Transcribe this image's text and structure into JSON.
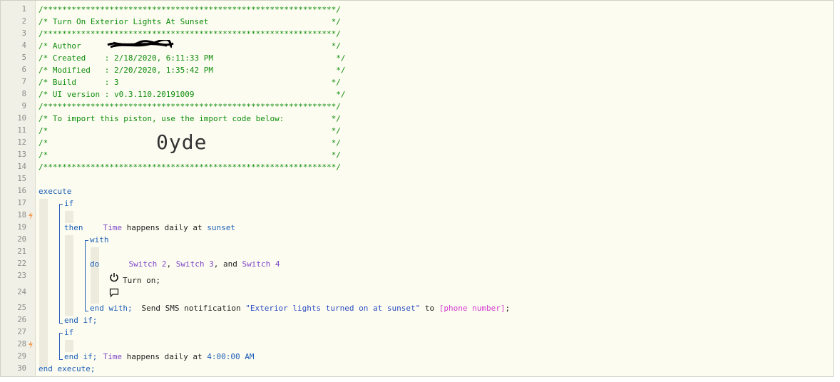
{
  "line_numbers": [
    "1",
    "2",
    "3",
    "4",
    "5",
    "6",
    "7",
    "8",
    "9",
    "10",
    "11",
    "12",
    "13",
    "14",
    "15",
    "16",
    "17",
    "18",
    "19",
    "20",
    "21",
    "22",
    "23",
    "24",
    "25",
    "26",
    "27",
    "28",
    "29",
    "30"
  ],
  "header": {
    "stars": "/**************************************************************/",
    "title": "/* Turn On Exterior Lights At Sunset                          */",
    "author": "/* Author                                                     */",
    "created": "/* Created    : 2/18/2020, 6:11:33 PM                          */",
    "modified": "/* Modified   : 2/20/2020, 1:35:42 PM                          */",
    "build": "/* Build      : 3                                             */",
    "ui_version": "/* UI version : v0.3.110.20191009                              */",
    "import_text": "/* To import this piston, use the import code below:          */",
    "blank": "/*                                                            */",
    "import_code": "0yde"
  },
  "code": {
    "execute": "execute",
    "if1": "if",
    "cond1_device": "Time",
    "cond1_text": " happens daily at ",
    "cond1_value": "sunset",
    "then": "then",
    "with": "with",
    "dev_switch2": "Switch 2",
    "comma1": ", ",
    "dev_switch3": "Switch 3",
    "and_text": ", and ",
    "dev_switch4": "Switch 4",
    "do": "do",
    "turn_on": "Turn on;",
    "send_sms": "Send SMS notification ",
    "sms_message": "\"Exterior lights turned on at sunset\"",
    "to_text": " to ",
    "phone": "[phone number]",
    "semicolon": ";",
    "end_with": "end with;",
    "end_if1": "end if;",
    "if2": "if",
    "cond2_device": "Time",
    "cond2_text": " happens daily at ",
    "cond2_value": "4:00:00 AM",
    "end_if2": "end if;",
    "end_execute": "end execute;"
  },
  "colors": {
    "comment": "#0e8d0e",
    "keyword": "#1c5fb7",
    "device": "#7b45c9",
    "string": "#2b4ec2",
    "variable": "#d33bd1",
    "trigger_bolt": "#f39c53"
  },
  "icons": [
    "lightning-bolt-icon",
    "power-icon",
    "speech-bubble-icon"
  ]
}
